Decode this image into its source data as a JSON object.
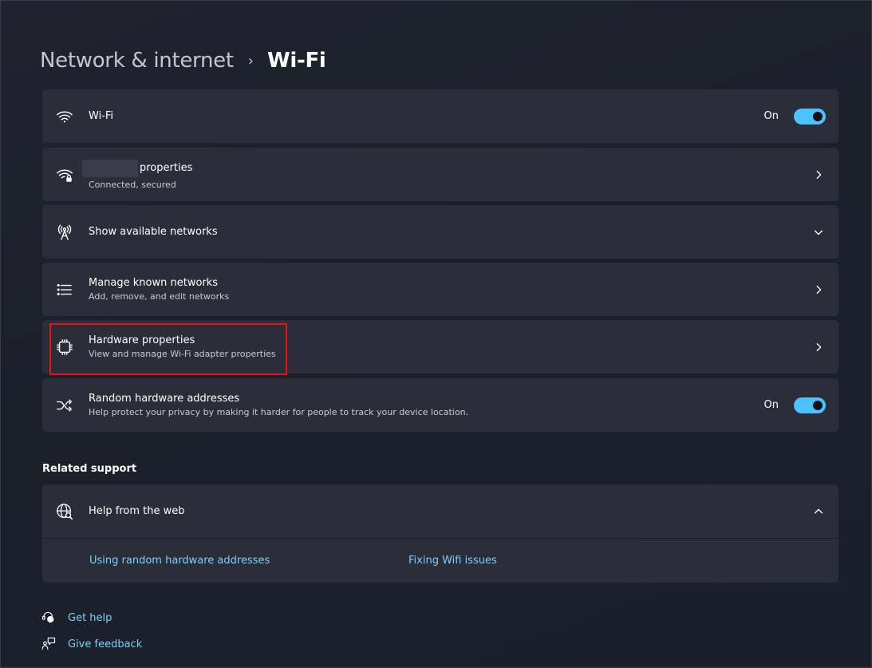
{
  "breadcrumb": {
    "parent": "Network & internet",
    "separator": "›",
    "current": "Wi-Fi"
  },
  "wifi": {
    "label": "Wi-Fi",
    "toggle_label": "On",
    "enabled": true,
    "icon": "wifi-icon"
  },
  "network_properties": {
    "label": "properties",
    "status": "Connected, secured",
    "icon": "wifi-lock-icon"
  },
  "available_networks": {
    "label": "Show available networks",
    "icon": "antenna-icon"
  },
  "known_networks": {
    "label": "Manage known networks",
    "subtitle": "Add, remove, and edit networks",
    "icon": "list-icon"
  },
  "hardware_properties": {
    "label": "Hardware properties",
    "subtitle": "View and manage Wi-Fi adapter properties",
    "icon": "chip-icon"
  },
  "random_addresses": {
    "label": "Random hardware addresses",
    "subtitle": "Help protect your privacy by making it harder for people to track your device location.",
    "toggle_label": "On",
    "enabled": true,
    "icon": "shuffle-icon"
  },
  "related_support": {
    "title": "Related support",
    "help_web": {
      "label": "Help from the web",
      "icon": "globe-search-icon"
    },
    "links": [
      "Using random hardware addresses",
      "Fixing Wifi issues"
    ]
  },
  "footer": {
    "get_help": "Get help",
    "give_feedback": "Give feedback"
  },
  "colors": {
    "accent": "#4cc2ff",
    "link": "#7ad0ff",
    "card": "#2b2e38",
    "highlight": "#e5141a"
  }
}
